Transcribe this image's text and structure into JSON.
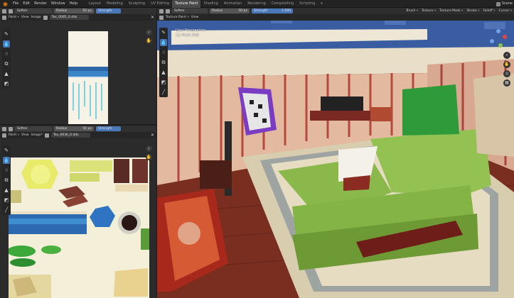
{
  "menu": [
    "File",
    "Edit",
    "Render",
    "Window",
    "Help"
  ],
  "workspaces": [
    {
      "label": "Layout",
      "active": false
    },
    {
      "label": "Modeling",
      "active": false
    },
    {
      "label": "Sculpting",
      "active": false
    },
    {
      "label": "UV Editing",
      "active": false
    },
    {
      "label": "Texture Paint",
      "active": true
    },
    {
      "label": "Shading",
      "active": false
    },
    {
      "label": "Animation",
      "active": false
    },
    {
      "label": "Rendering",
      "active": false
    },
    {
      "label": "Compositing",
      "active": false
    },
    {
      "label": "Scripting",
      "active": false
    }
  ],
  "scene_label": "Scene",
  "left_top": {
    "brush": "Soften",
    "radius_label": "Radius",
    "radius_value": "50 px",
    "strength_label": "Strength",
    "mode": "Paint",
    "view": "View",
    "image": "Image",
    "image_name": "Tex_0065_0.dds"
  },
  "left_bottom": {
    "brush": "Soften",
    "radius_label": "Radius",
    "radius_value": "50 px",
    "strength_label": "Strength",
    "mode": "Paint",
    "view": "View",
    "image": "Image*",
    "image_name": "Tex_0036_0.dds"
  },
  "viewport": {
    "mode": "Texture Paint",
    "view": "View",
    "brush": "Soften",
    "radius_label": "Radius",
    "radius_value": "50 px",
    "strength_label": "Strength",
    "strength_value": "1.000",
    "menus": [
      "Brush",
      "Texture",
      "Texture Mask",
      "Stroke",
      "Falloff",
      "Cursor"
    ],
    "overlay_line1": "User Perspective",
    "overlay_line2": "(1) Mesh.008"
  },
  "icons": {
    "tools": [
      "draw-icon",
      "soften-icon",
      "smear-icon",
      "clone-icon",
      "fill-icon",
      "mask-icon",
      "annotate-icon"
    ],
    "nav": [
      "zoom-icon",
      "hand-icon"
    ]
  },
  "colors": {
    "accent": "#4772b3",
    "active_tab": "#4a4a4a",
    "blender_orange": "#e87d0d"
  }
}
